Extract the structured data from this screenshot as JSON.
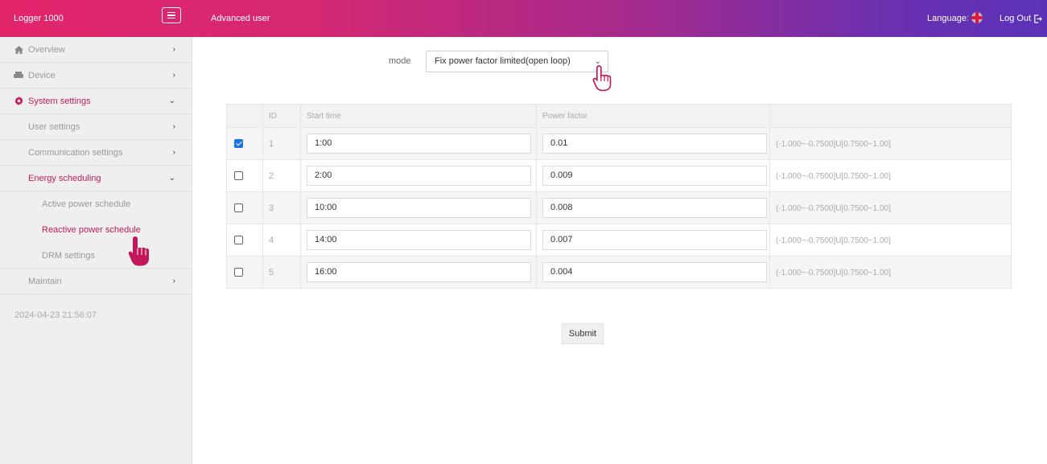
{
  "header": {
    "brand": "Logger 1000",
    "user_role": "Advanced user",
    "language_label": "Language:",
    "logout_label": "Log Out"
  },
  "sidebar": {
    "items": [
      {
        "label": "Overview",
        "icon": "home-icon"
      },
      {
        "label": "Device",
        "icon": "device-icon"
      },
      {
        "label": "System settings",
        "icon": "gear-icon"
      },
      {
        "label": "User settings"
      },
      {
        "label": "Communication settings"
      },
      {
        "label": "Energy scheduling"
      },
      {
        "label": "Active power schedule"
      },
      {
        "label": "Reactive power schedule"
      },
      {
        "label": "DRM settings"
      },
      {
        "label": "Maintain"
      }
    ],
    "timestamp": "2024-04-23 21:56:07"
  },
  "main": {
    "mode_label": "mode",
    "mode_value": "Fix power factor limited(open loop)",
    "table": {
      "headers": [
        "",
        "ID",
        "Start time",
        "Power factor",
        ""
      ],
      "rows": [
        {
          "checked": true,
          "id": "1",
          "start_time": "1:00",
          "power_factor": "0.01",
          "range": "(-1.000~-0.7500]U[0.7500~1.00]"
        },
        {
          "checked": false,
          "id": "2",
          "start_time": "2:00",
          "power_factor": "0.009",
          "range": "(-1.000~-0.7500]U[0.7500~1.00]"
        },
        {
          "checked": false,
          "id": "3",
          "start_time": "10:00",
          "power_factor": "0.008",
          "range": "(-1.000~-0.7500]U[0.7500~1.00]"
        },
        {
          "checked": false,
          "id": "4",
          "start_time": "14:00",
          "power_factor": "0.007",
          "range": "(-1.000~-0.7500]U[0.7500~1.00]"
        },
        {
          "checked": false,
          "id": "5",
          "start_time": "16:00",
          "power_factor": "0.004",
          "range": "(-1.000~-0.7500]U[0.7500~1.00]"
        }
      ]
    },
    "submit_label": "Submit"
  },
  "colors": {
    "accent": "#c2185b",
    "header_start": "#e3256b",
    "header_end": "#5a32b8",
    "checkbox_on": "#1a73e8"
  }
}
